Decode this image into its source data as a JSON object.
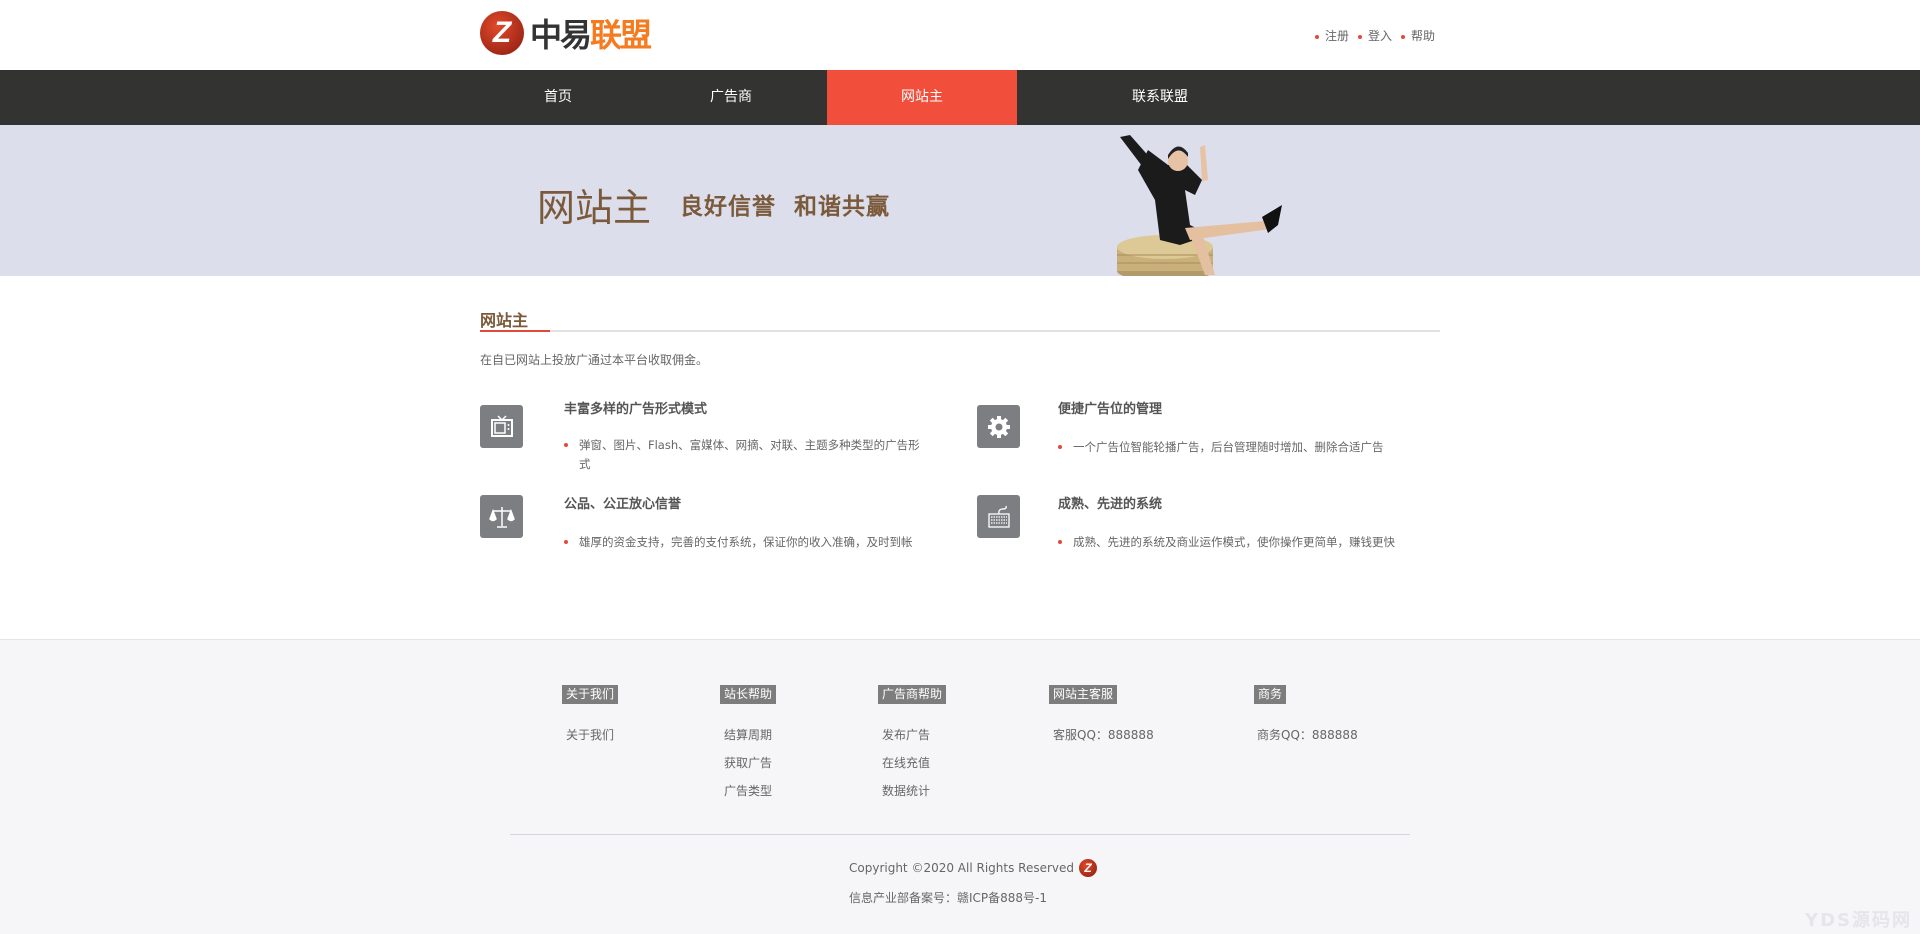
{
  "header": {
    "logo_text_dark": "中易",
    "logo_text_accent": "联盟",
    "logo_mark": "Z",
    "links": [
      "注册",
      "登入",
      "帮助"
    ]
  },
  "nav": {
    "items": [
      {
        "label": "首页"
      },
      {
        "label": "广告商"
      },
      {
        "label": "网站主",
        "active": true
      },
      {
        "label": "联系联盟"
      }
    ]
  },
  "banner": {
    "title": "网站主",
    "subtitle": "良好信誉  和谐共赢"
  },
  "section": {
    "title": "网站主",
    "intro": "在自已网站上投放广通过本平台收取佣金。"
  },
  "features": [
    {
      "icon": "tv-icon",
      "title": "丰富多样的广告形式模式",
      "desc": "弹窗、图片、Flash、富媒体、网摘、对联、主题多种类型的广告形式"
    },
    {
      "icon": "gear-icon",
      "title": "便捷广告位的管理",
      "desc": "一个广告位智能轮播广告，后台管理随时增加、删除合适广告"
    },
    {
      "icon": "scale-icon",
      "title": "公品、公正放心信誉",
      "desc": "雄厚的资金支持，完善的支付系统，保证你的收入准确，及时到帐"
    },
    {
      "icon": "keyboard-icon",
      "title": "成熟、先进的系统",
      "desc": "成熟、先进的系统及商业运作模式，使你操作更简单，赚钱更快"
    }
  ],
  "footer": {
    "columns": [
      {
        "heading": "关于我们",
        "links": [
          "关于我们"
        ]
      },
      {
        "heading": "站长帮助",
        "links": [
          "结算周期",
          "获取广告",
          "广告类型"
        ]
      },
      {
        "heading": "广告商帮助",
        "links": [
          "发布广告",
          "在线充值",
          "数据统计"
        ]
      },
      {
        "heading": "网站主客服",
        "links": [
          "客服QQ：888888"
        ]
      },
      {
        "heading": "商务",
        "links": [
          "商务QQ：888888"
        ]
      }
    ],
    "copyright": "Copyright ©2020 All Rights Reserved",
    "icp": "信息产业部备案号：赣ICP备888号-1",
    "watermark": "YDS源码网"
  },
  "colors": {
    "accent": "#f14f3c",
    "nav_bg": "#333331",
    "banner_bg": "#dcdeeb",
    "title_brown": "#7b5a3b",
    "logo_orange": "#f47b20"
  }
}
